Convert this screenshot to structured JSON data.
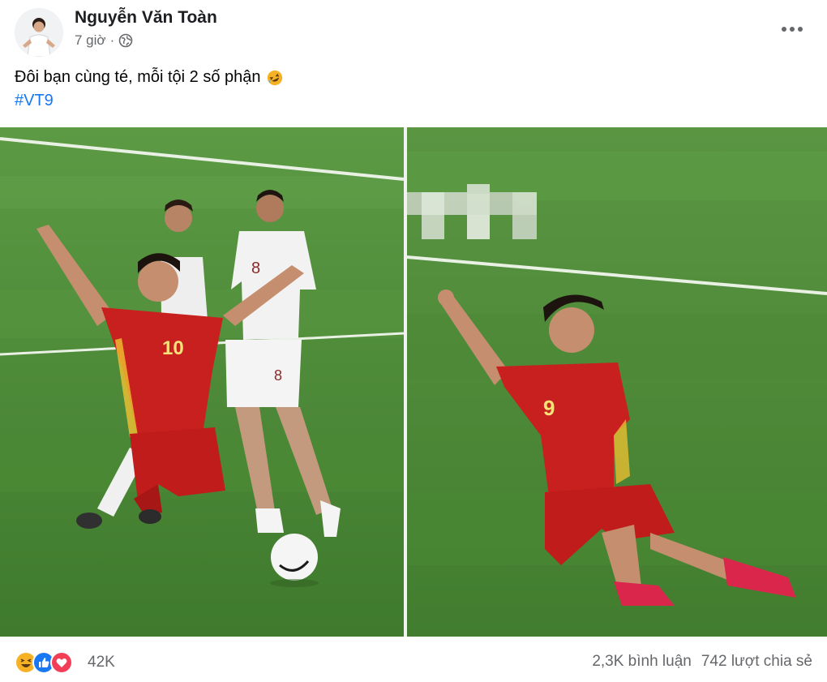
{
  "post": {
    "author": "Nguyễn Văn Toàn",
    "time": "7 giờ",
    "separator": "·",
    "privacy_icon": "globe-icon",
    "more_icon": "more-horizontal-icon",
    "caption": "Đôi bạn cùng té, mỗi tội 2 số phận",
    "caption_emoji": "rolling-on-floor-laughing-emoji",
    "hashtag": "#VT9"
  },
  "photo": {
    "left_jersey_number": "10",
    "right_jersey_number": "9",
    "opponent_numbers": [
      "8",
      "8"
    ]
  },
  "footer": {
    "reaction_icons": [
      "haha-icon",
      "like-icon",
      "love-icon"
    ],
    "reaction_count": "42K",
    "comments": "2,3K bình luận",
    "shares": "742 lượt chia sẻ"
  },
  "colors": {
    "link": "#1877f2",
    "secondary_text": "#65676b",
    "pitch": "#4f8a3a",
    "vietnam_red": "#c8201e",
    "like_blue": "#1877f2",
    "love_red": "#f33e58",
    "haha_yellow": "#f7b125"
  }
}
